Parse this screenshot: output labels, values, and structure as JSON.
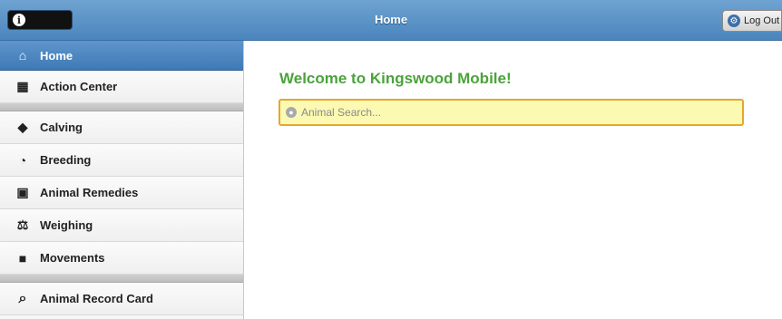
{
  "header": {
    "title": "Home",
    "logout_label": "Log Out",
    "info_icon": "i"
  },
  "sidebar": {
    "items": [
      {
        "label": "Home",
        "icon": "home-icon",
        "glyph": "🏠"
      },
      {
        "label": "Action Center",
        "icon": "calendar-icon",
        "glyph": "📅"
      },
      {
        "label": "Calving",
        "icon": "tags-icon",
        "glyph": "🏷"
      },
      {
        "label": "Breeding",
        "icon": "clock-icon",
        "glyph": "⏱"
      },
      {
        "label": "Animal Remedies",
        "icon": "medkit-icon",
        "glyph": "⛑"
      },
      {
        "label": "Weighing",
        "icon": "scale-icon",
        "glyph": "⚖"
      },
      {
        "label": "Movements",
        "icon": "truck-icon",
        "glyph": "🚚"
      },
      {
        "label": "Animal Record Card",
        "icon": "search-icon",
        "glyph": "🔍"
      }
    ]
  },
  "main": {
    "welcome": "Welcome to Kingswood Mobile!",
    "search_placeholder": "Animal Search..."
  },
  "colors": {
    "header": "#4a85bd",
    "active_nav": "#3f7ab5",
    "welcome_text": "#4aa33b",
    "search_bg": "#fbf9b2",
    "search_border": "#e4a82b"
  }
}
